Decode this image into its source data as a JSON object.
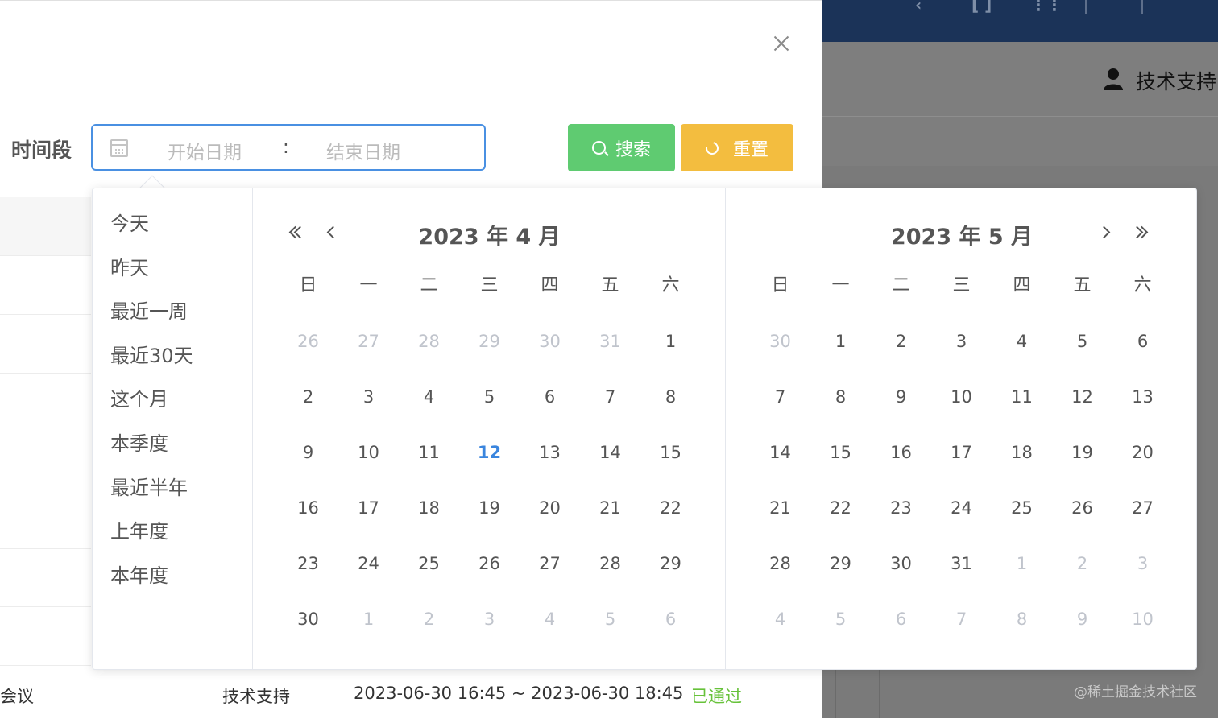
{
  "background": {
    "user_label": "技术支持",
    "watermark": "@稀土掘金技术社区"
  },
  "modal": {
    "close_label": "×",
    "form_label": "时间段",
    "range_input": {
      "start_placeholder": "开始日期",
      "separator": ":",
      "end_placeholder": "结束日期"
    },
    "search_button": "搜索",
    "reset_button": "重置",
    "bottom_row": {
      "col1": "会议",
      "col2": "技术支持",
      "col3": "2023-06-30 16:45 ~ 2023-06-30 18:45",
      "col4": "已通过"
    }
  },
  "picker": {
    "shortcuts": [
      "今天",
      "昨天",
      "最近一周",
      "最近30天",
      "这个月",
      "本季度",
      "最近半年",
      "上年度",
      "本年度"
    ],
    "weekdays": [
      "日",
      "一",
      "二",
      "三",
      "四",
      "五",
      "六"
    ],
    "left_panel": {
      "title": "2023 年 4 月",
      "today": "12",
      "weeks": [
        [
          [
            "26",
            "m"
          ],
          [
            "27",
            "m"
          ],
          [
            "28",
            "m"
          ],
          [
            "29",
            "m"
          ],
          [
            "30",
            "m"
          ],
          [
            "31",
            "m"
          ],
          [
            "1",
            ""
          ]
        ],
        [
          [
            "2",
            ""
          ],
          [
            "3",
            ""
          ],
          [
            "4",
            ""
          ],
          [
            "5",
            ""
          ],
          [
            "6",
            ""
          ],
          [
            "7",
            ""
          ],
          [
            "8",
            ""
          ]
        ],
        [
          [
            "9",
            ""
          ],
          [
            "10",
            ""
          ],
          [
            "11",
            ""
          ],
          [
            "12",
            "t"
          ],
          [
            "13",
            ""
          ],
          [
            "14",
            ""
          ],
          [
            "15",
            ""
          ]
        ],
        [
          [
            "16",
            ""
          ],
          [
            "17",
            ""
          ],
          [
            "18",
            ""
          ],
          [
            "19",
            ""
          ],
          [
            "20",
            ""
          ],
          [
            "21",
            ""
          ],
          [
            "22",
            ""
          ]
        ],
        [
          [
            "23",
            ""
          ],
          [
            "24",
            ""
          ],
          [
            "25",
            ""
          ],
          [
            "26",
            ""
          ],
          [
            "27",
            ""
          ],
          [
            "28",
            ""
          ],
          [
            "29",
            ""
          ]
        ],
        [
          [
            "30",
            ""
          ],
          [
            "1",
            "m"
          ],
          [
            "2",
            "m"
          ],
          [
            "3",
            "m"
          ],
          [
            "4",
            "m"
          ],
          [
            "5",
            "m"
          ],
          [
            "6",
            "m"
          ]
        ]
      ]
    },
    "right_panel": {
      "title": "2023 年 5 月",
      "weeks": [
        [
          [
            "30",
            "m"
          ],
          [
            "1",
            ""
          ],
          [
            "2",
            ""
          ],
          [
            "3",
            ""
          ],
          [
            "4",
            ""
          ],
          [
            "5",
            ""
          ],
          [
            "6",
            ""
          ]
        ],
        [
          [
            "7",
            ""
          ],
          [
            "8",
            ""
          ],
          [
            "9",
            ""
          ],
          [
            "10",
            ""
          ],
          [
            "11",
            ""
          ],
          [
            "12",
            ""
          ],
          [
            "13",
            ""
          ]
        ],
        [
          [
            "14",
            ""
          ],
          [
            "15",
            ""
          ],
          [
            "16",
            ""
          ],
          [
            "17",
            ""
          ],
          [
            "18",
            ""
          ],
          [
            "19",
            ""
          ],
          [
            "20",
            ""
          ]
        ],
        [
          [
            "21",
            ""
          ],
          [
            "22",
            ""
          ],
          [
            "23",
            ""
          ],
          [
            "24",
            ""
          ],
          [
            "25",
            ""
          ],
          [
            "26",
            ""
          ],
          [
            "27",
            ""
          ]
        ],
        [
          [
            "28",
            ""
          ],
          [
            "29",
            ""
          ],
          [
            "30",
            ""
          ],
          [
            "31",
            ""
          ],
          [
            "1",
            "m"
          ],
          [
            "2",
            "m"
          ],
          [
            "3",
            "m"
          ]
        ],
        [
          [
            "4",
            "m"
          ],
          [
            "5",
            "m"
          ],
          [
            "6",
            "m"
          ],
          [
            "7",
            "m"
          ],
          [
            "8",
            "m"
          ],
          [
            "9",
            "m"
          ],
          [
            "10",
            "m"
          ]
        ]
      ]
    },
    "colors": {
      "today": "#3a85de",
      "muted": "#c0c4cc",
      "search": "#5fcb71",
      "reset": "#f3bd3f",
      "focus_border": "#4a90e2"
    }
  }
}
